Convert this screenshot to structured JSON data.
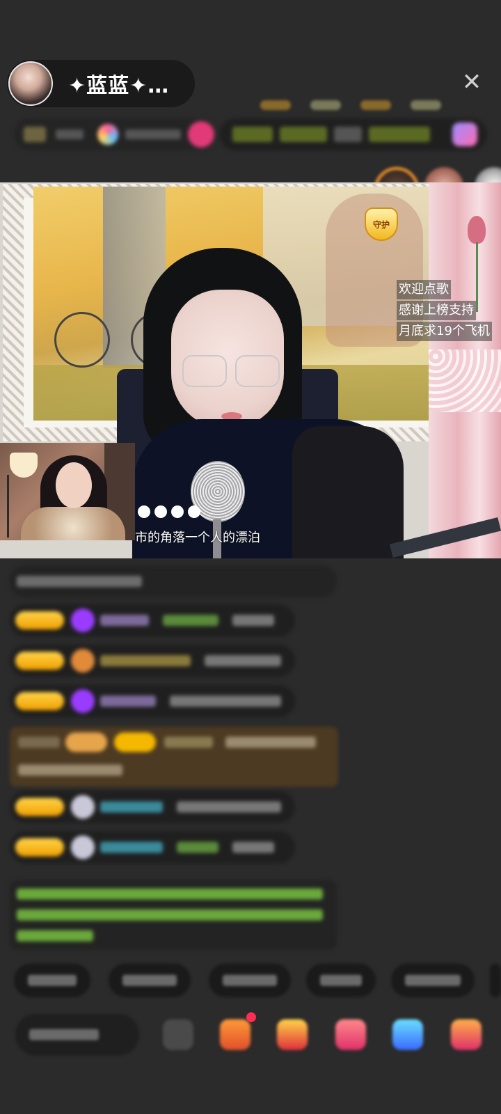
{
  "header": {
    "host_name": "✦蓝蓝✦…",
    "close_symbol": "✕"
  },
  "video": {
    "guard_badge": "守护",
    "notice_lines": [
      "欢迎点歌",
      "感谢上榜支持",
      "月底求19个飞机"
    ],
    "lyric": "市的角落一个人的漂泊"
  },
  "icons": {
    "close": "close-icon",
    "guard": "guard-badge-icon",
    "gift": "gift-icon",
    "more": "more-icon"
  },
  "colors": {
    "background": "#2b2b2b",
    "badge_gold": "#f0a000",
    "notify_red": "#ff2d55"
  }
}
